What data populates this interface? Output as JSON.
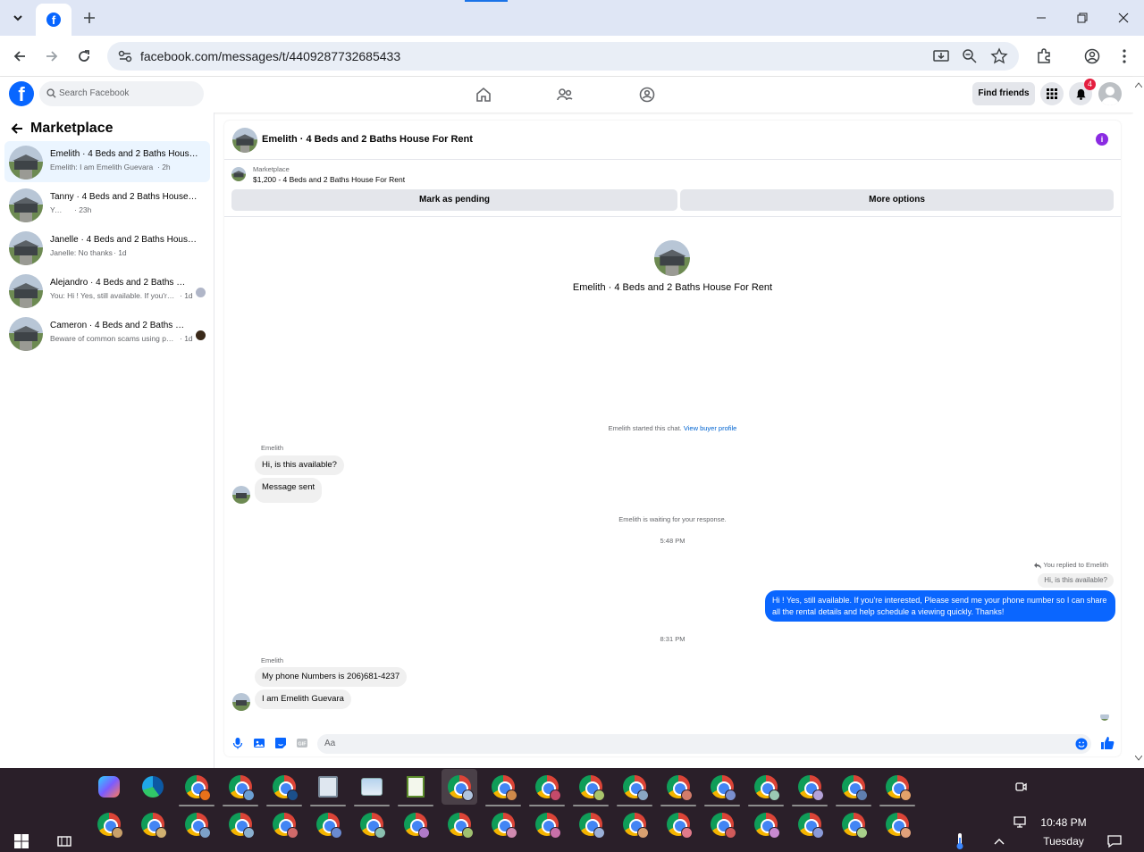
{
  "browser": {
    "url": "facebook.com/messages/t/4409287732685433"
  },
  "fb_header": {
    "search_placeholder": "Search Facebook",
    "find_friends": "Find friends",
    "notification_count": "4"
  },
  "sidebar": {
    "title": "Marketplace",
    "conversations": [
      {
        "name": "Emelith · 4 Beds and 2 Baths House For Rent",
        "preview": "Emelith: I am Emelith Guevara",
        "time": "· 2h",
        "active": true
      },
      {
        "name": "Tanny · 4 Beds and 2 Baths House For Rent",
        "preview": "You: >",
        "time": "· 23h"
      },
      {
        "name": "Janelle · 4 Beds and 2 Baths House For Rent",
        "preview": "Janelle: No thanks",
        "time": "· 1d"
      },
      {
        "name": "Alejandro · 4 Beds and 2 Baths House For Rent",
        "preview": "You: Hi ! Yes, still available. If you're interested",
        "time": "· 1d"
      },
      {
        "name": "Cameron · 4 Beds and 2 Baths House For Rent",
        "preview": "Beware of common scams using payment apps",
        "time": "· 1d"
      }
    ]
  },
  "chat": {
    "title": "Emelith · 4 Beds and 2 Baths House For Rent",
    "listing_source": "Marketplace",
    "listing_price_title": "$1,200 - 4 Beds and 2 Baths House For Rent",
    "mark_pending": "Mark as pending",
    "more_options": "More options",
    "center_name": "Emelith · 4 Beds and 2 Baths House For Rent",
    "started_text": "Emelith started this chat.",
    "view_profile": "View buyer profile",
    "sender_label": "Emelith",
    "msg1": "Hi, is this available?",
    "msg2": "Message sent",
    "waiting_text": "Emelith is waiting for your response.",
    "time1": "5:48 PM",
    "replied_to": "You replied to Emelith",
    "quoted_text": "Hi, is this available?",
    "my_reply": "Hi ! Yes, still available. If you're interested, Please send me your phone number so I can share all the rental details and help schedule a viewing quickly. Thanks!",
    "time2": "8:31 PM",
    "sender_label2": "Emelith",
    "msg3": "My phone Numbers is 206)681-4237",
    "msg4": "I am Emelith Guevara",
    "composer_placeholder": "Aa"
  },
  "taskbar": {
    "time": "10:48 PM",
    "day": "Tuesday"
  },
  "colors": {
    "fb_blue": "#0866ff",
    "bubble_out": "#0a66ff",
    "taskbar_bg": "#2a1f29"
  }
}
